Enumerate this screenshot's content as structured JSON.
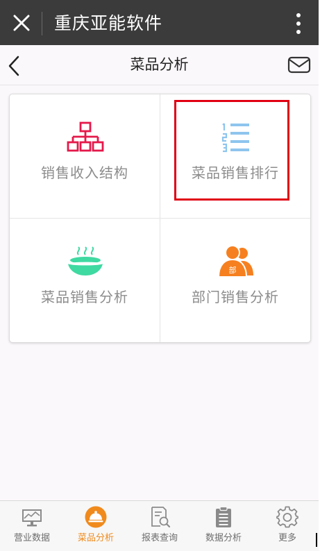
{
  "app": {
    "title": "重庆亚能软件"
  },
  "nav": {
    "title": "菜品分析"
  },
  "grid": {
    "items": [
      {
        "label": "销售收入结构",
        "icon": "org-chart-icon",
        "color": "#e5184a"
      },
      {
        "label": "菜品销售排行",
        "icon": "ranked-list-icon",
        "color": "#8ec5ee",
        "highlighted": true
      },
      {
        "label": "菜品销售分析",
        "icon": "dish-bowl-icon",
        "color": "#3fd9a2"
      },
      {
        "label": "部门销售分析",
        "icon": "department-people-icon",
        "color": "#f6801f",
        "badge": "部"
      }
    ]
  },
  "tabs": [
    {
      "label": "营业数据",
      "icon": "monitor-chart-icon"
    },
    {
      "label": "菜品分析",
      "icon": "dish-cover-icon",
      "active": true
    },
    {
      "label": "报表查询",
      "icon": "report-search-icon"
    },
    {
      "label": "数据分析",
      "icon": "clipboard-icon"
    },
    {
      "label": "更多",
      "icon": "gear-icon"
    }
  ],
  "colors": {
    "accent": "#f08a1c",
    "highlight": "#e00012",
    "topbar": "#3b3b3b"
  }
}
